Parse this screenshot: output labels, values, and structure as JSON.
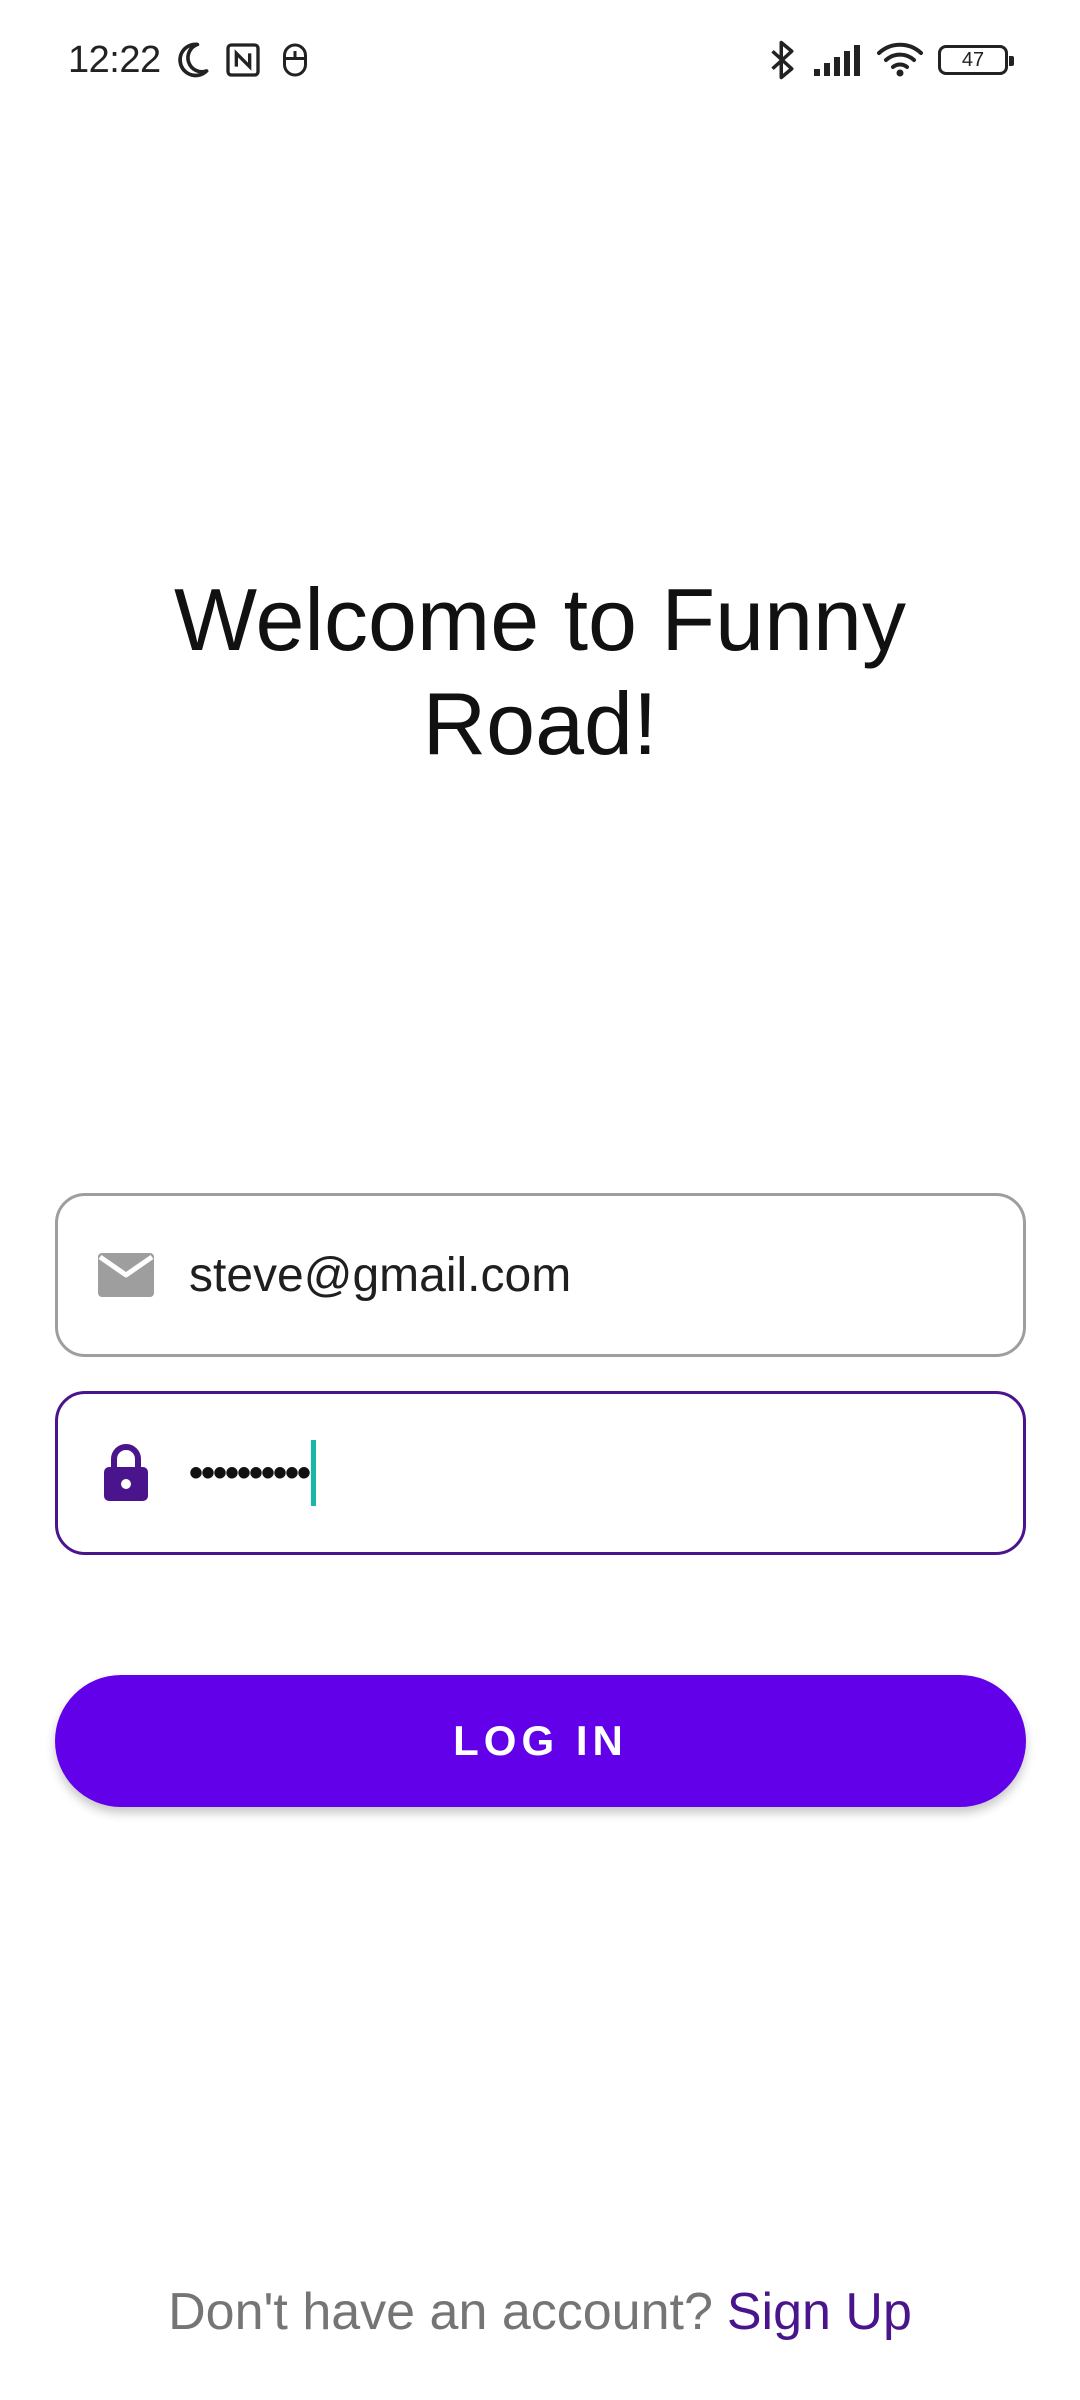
{
  "status_bar": {
    "time": "12:22",
    "left_icons": [
      "moon-icon",
      "nfc-icon",
      "mouse-icon"
    ],
    "right_icons": [
      "bluetooth-icon",
      "signal-icon",
      "wifi-icon"
    ],
    "battery_level": "47"
  },
  "welcome": {
    "line1": "Welcome to Funny",
    "line2": "Road!"
  },
  "email_field": {
    "value": "steve@gmail.com",
    "icon": "mail-icon"
  },
  "password_field": {
    "masked_value": "••••••••••",
    "icon": "lock-icon"
  },
  "login_button": {
    "label": "LOG IN"
  },
  "footer": {
    "prompt": "Don't have an account?",
    "link": "Sign Up"
  },
  "colors": {
    "accent": "#6200ea",
    "focus_border": "#4a148c",
    "caret": "#18b8a8",
    "link": "#4a148c"
  }
}
